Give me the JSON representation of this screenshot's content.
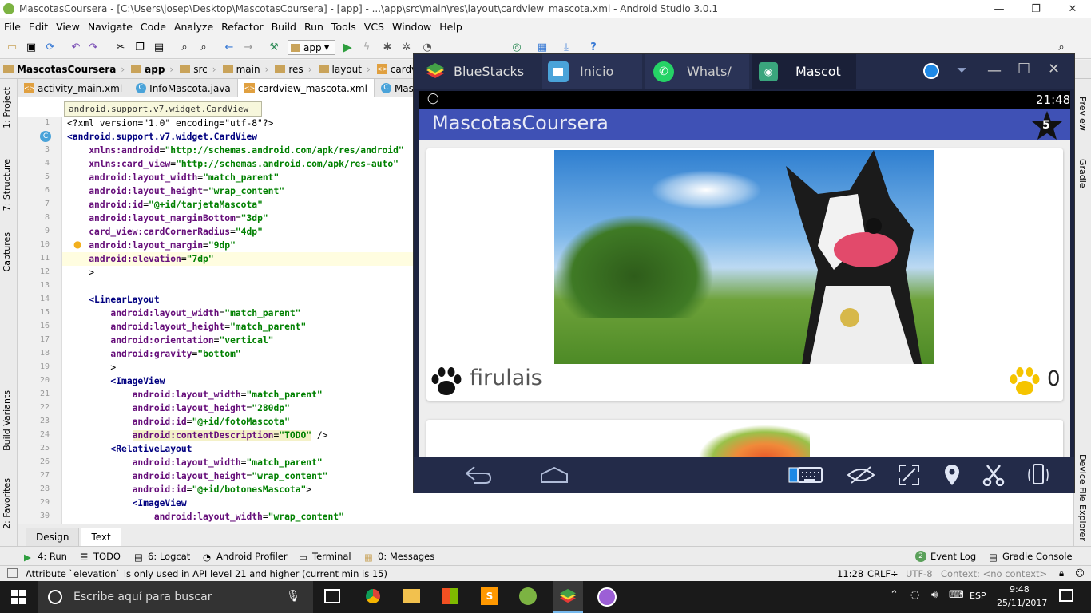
{
  "window": {
    "title": "MascotasCoursera - [C:\\Users\\josep\\Desktop\\MascotasCoursera] - [app] - ...\\app\\src\\main\\res\\layout\\cardview_mascota.xml - Android Studio 3.0.1",
    "minimize": "—",
    "restore": "❐",
    "close": "✕"
  },
  "menu": [
    "File",
    "Edit",
    "View",
    "Navigate",
    "Code",
    "Analyze",
    "Refactor",
    "Build",
    "Run",
    "Tools",
    "VCS",
    "Window",
    "Help"
  ],
  "toolbar": {
    "run_config": "app"
  },
  "breadcrumb": [
    "MascotasCoursera",
    "app",
    "src",
    "main",
    "res",
    "layout",
    "cardview_masco"
  ],
  "tabs": [
    {
      "label": "activity_main.xml",
      "icon": "xml"
    },
    {
      "label": "InfoMascota.java",
      "icon": "c"
    },
    {
      "label": "cardview_mascota.xml",
      "icon": "xml"
    },
    {
      "label": "Masco",
      "icon": "c"
    }
  ],
  "tooltip": "android.support.v7.widget.CardView",
  "left_panels": [
    "1: Project",
    "7: Structure",
    "Captures",
    "Build Variants",
    "2: Favorites"
  ],
  "right_panels": [
    "Preview",
    "Gradle",
    "Device File Explorer"
  ],
  "code": [
    {
      "n": "1",
      "parts": [
        [
          "t",
          "<?xml version=\"1.0\" encoding=\"utf-8\"?>"
        ]
      ]
    },
    {
      "n": "2",
      "parts": [
        [
          "tag",
          "<android.support.v7.widget.CardView"
        ]
      ]
    },
    {
      "n": "3",
      "parts": [
        [
          "sp",
          "    "
        ],
        [
          "attr",
          "xmlns:android"
        ],
        [
          "t",
          "="
        ],
        [
          "val",
          "\"http://schemas.android.com/apk/res/android\""
        ]
      ]
    },
    {
      "n": "4",
      "parts": [
        [
          "sp",
          "    "
        ],
        [
          "attr",
          "xmlns:card_view"
        ],
        [
          "t",
          "="
        ],
        [
          "val",
          "\"http://schemas.android.com/apk/res-auto\""
        ]
      ]
    },
    {
      "n": "5",
      "parts": [
        [
          "sp",
          "    "
        ],
        [
          "attr",
          "android:layout_width"
        ],
        [
          "t",
          "="
        ],
        [
          "val",
          "\"match_parent\""
        ]
      ]
    },
    {
      "n": "6",
      "parts": [
        [
          "sp",
          "    "
        ],
        [
          "attr",
          "android:layout_height"
        ],
        [
          "t",
          "="
        ],
        [
          "val",
          "\"wrap_content\""
        ]
      ]
    },
    {
      "n": "7",
      "parts": [
        [
          "sp",
          "    "
        ],
        [
          "attr",
          "android:id"
        ],
        [
          "t",
          "="
        ],
        [
          "val",
          "\"@+id/tarjetaMascota\""
        ]
      ]
    },
    {
      "n": "8",
      "parts": [
        [
          "sp",
          "    "
        ],
        [
          "attr",
          "android:layout_marginBottom"
        ],
        [
          "t",
          "="
        ],
        [
          "val",
          "\"3dp\""
        ]
      ]
    },
    {
      "n": "9",
      "parts": [
        [
          "sp",
          "    "
        ],
        [
          "attr",
          "card_view:cardCornerRadius"
        ],
        [
          "t",
          "="
        ],
        [
          "val",
          "\"4dp\""
        ]
      ]
    },
    {
      "n": "10",
      "parts": [
        [
          "sp",
          "    "
        ],
        [
          "attr",
          "android:layout_margin"
        ],
        [
          "t",
          "="
        ],
        [
          "val",
          "\"9dp\""
        ]
      ]
    },
    {
      "n": "11",
      "parts": [
        [
          "sp",
          "    "
        ],
        [
          "attr",
          "android:elevation"
        ],
        [
          "t",
          "="
        ],
        [
          "val",
          "\"7dp\""
        ]
      ]
    },
    {
      "n": "12",
      "parts": [
        [
          "t",
          "    >"
        ]
      ]
    },
    {
      "n": "13",
      "parts": [
        [
          "t",
          ""
        ]
      ]
    },
    {
      "n": "14",
      "parts": [
        [
          "sp",
          "    "
        ],
        [
          "tag",
          "<LinearLayout"
        ]
      ]
    },
    {
      "n": "15",
      "parts": [
        [
          "sp",
          "        "
        ],
        [
          "attr",
          "android:layout_width"
        ],
        [
          "t",
          "="
        ],
        [
          "val",
          "\"match_parent\""
        ]
      ]
    },
    {
      "n": "16",
      "parts": [
        [
          "sp",
          "        "
        ],
        [
          "attr",
          "android:layout_height"
        ],
        [
          "t",
          "="
        ],
        [
          "val",
          "\"match_parent\""
        ]
      ]
    },
    {
      "n": "17",
      "parts": [
        [
          "sp",
          "        "
        ],
        [
          "attr",
          "android:orientation"
        ],
        [
          "t",
          "="
        ],
        [
          "val",
          "\"vertical\""
        ]
      ]
    },
    {
      "n": "18",
      "parts": [
        [
          "sp",
          "        "
        ],
        [
          "attr",
          "android:gravity"
        ],
        [
          "t",
          "="
        ],
        [
          "val",
          "\"bottom\""
        ]
      ]
    },
    {
      "n": "19",
      "parts": [
        [
          "t",
          "        >"
        ]
      ]
    },
    {
      "n": "20",
      "parts": [
        [
          "sp",
          "        "
        ],
        [
          "tag",
          "<ImageView"
        ]
      ]
    },
    {
      "n": "21",
      "parts": [
        [
          "sp",
          "            "
        ],
        [
          "attr",
          "android:layout_width"
        ],
        [
          "t",
          "="
        ],
        [
          "val",
          "\"match_parent\""
        ]
      ]
    },
    {
      "n": "22",
      "parts": [
        [
          "sp",
          "            "
        ],
        [
          "attr",
          "android:layout_height"
        ],
        [
          "t",
          "="
        ],
        [
          "val",
          "\"280dp\""
        ]
      ]
    },
    {
      "n": "23",
      "parts": [
        [
          "sp",
          "            "
        ],
        [
          "attr",
          "android:id"
        ],
        [
          "t",
          "="
        ],
        [
          "val",
          "\"@+id/fotoMascota\""
        ]
      ]
    },
    {
      "n": "24",
      "parts": [
        [
          "sp",
          "            "
        ],
        [
          "attr",
          "android:contentDescription"
        ],
        [
          "t",
          "="
        ],
        [
          "val",
          "\"TODO\""
        ],
        [
          "t",
          " />"
        ]
      ]
    },
    {
      "n": "25",
      "parts": [
        [
          "sp",
          "        "
        ],
        [
          "tag",
          "<RelativeLayout"
        ]
      ]
    },
    {
      "n": "26",
      "parts": [
        [
          "sp",
          "            "
        ],
        [
          "attr",
          "android:layout_width"
        ],
        [
          "t",
          "="
        ],
        [
          "val",
          "\"match_parent\""
        ]
      ]
    },
    {
      "n": "27",
      "parts": [
        [
          "sp",
          "            "
        ],
        [
          "attr",
          "android:layout_height"
        ],
        [
          "t",
          "="
        ],
        [
          "val",
          "\"wrap_content\""
        ]
      ]
    },
    {
      "n": "28",
      "parts": [
        [
          "sp",
          "            "
        ],
        [
          "attr",
          "android:id"
        ],
        [
          "t",
          "="
        ],
        [
          "val",
          "\"@+id/botonesMascota\""
        ],
        [
          "t",
          ">"
        ]
      ]
    },
    {
      "n": "29",
      "parts": [
        [
          "sp",
          "            "
        ],
        [
          "tag",
          "<ImageView"
        ]
      ]
    },
    {
      "n": "30",
      "parts": [
        [
          "sp",
          "                "
        ],
        [
          "attr",
          "android:layout_width"
        ],
        [
          "t",
          "="
        ],
        [
          "val",
          "\"wrap_content\""
        ]
      ]
    }
  ],
  "design_tabs": [
    "Design",
    "Text"
  ],
  "tool_windows": {
    "left": [
      "4: Run",
      "TODO",
      "6: Logcat",
      "Android Profiler",
      "Terminal",
      "0: Messages"
    ],
    "right": [
      "Event Log",
      "Gradle Console"
    ],
    "event_count": "2"
  },
  "status": {
    "message": "Attribute `elevation` is only used in API level 21 and higher (current min is 15)",
    "position": "11:28",
    "line_sep": "CRLF÷",
    "encoding": "UTF-8",
    "context": "Context: <no context>"
  },
  "bluestacks": {
    "title": "BlueStacks",
    "tabs": [
      "Inicio",
      "Whats/",
      "Mascot"
    ],
    "phone": {
      "time": "21:48",
      "app_title": "MascotasCoursera",
      "star_count": "5",
      "pet_name": "firulais",
      "likes": "0"
    }
  },
  "taskbar": {
    "search_placeholder": "Escribe aquí para buscar",
    "lang": "ESP",
    "time": "9:48",
    "date": "25/11/2017"
  }
}
